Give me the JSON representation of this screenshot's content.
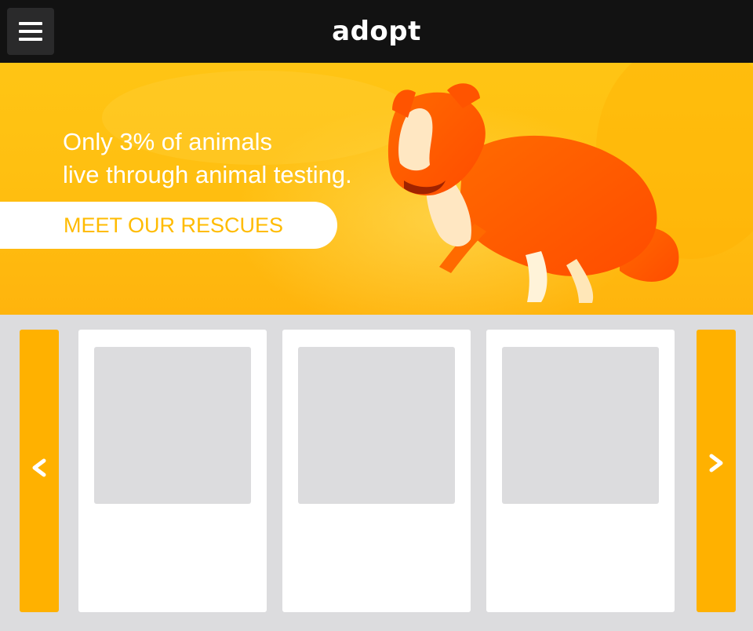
{
  "header": {
    "logo_text": "adopt",
    "menu_icon": "hamburger-menu-icon",
    "background": "#121212"
  },
  "hero": {
    "headline_line1": "Only 3% of animals",
    "headline_line2": "live through animal testing.",
    "cta_label": "MEET OUR RESCUES",
    "image_subject": "running dog, orange duotone",
    "accent_color": "#ffbb00"
  },
  "carousel": {
    "prev_icon": "chevron-left-icon",
    "next_icon": "chevron-right-icon",
    "arrow_color": "#ffb100",
    "cards": [
      {
        "image": "placeholder-image"
      },
      {
        "image": "placeholder-image"
      },
      {
        "image": "placeholder-image"
      }
    ]
  }
}
